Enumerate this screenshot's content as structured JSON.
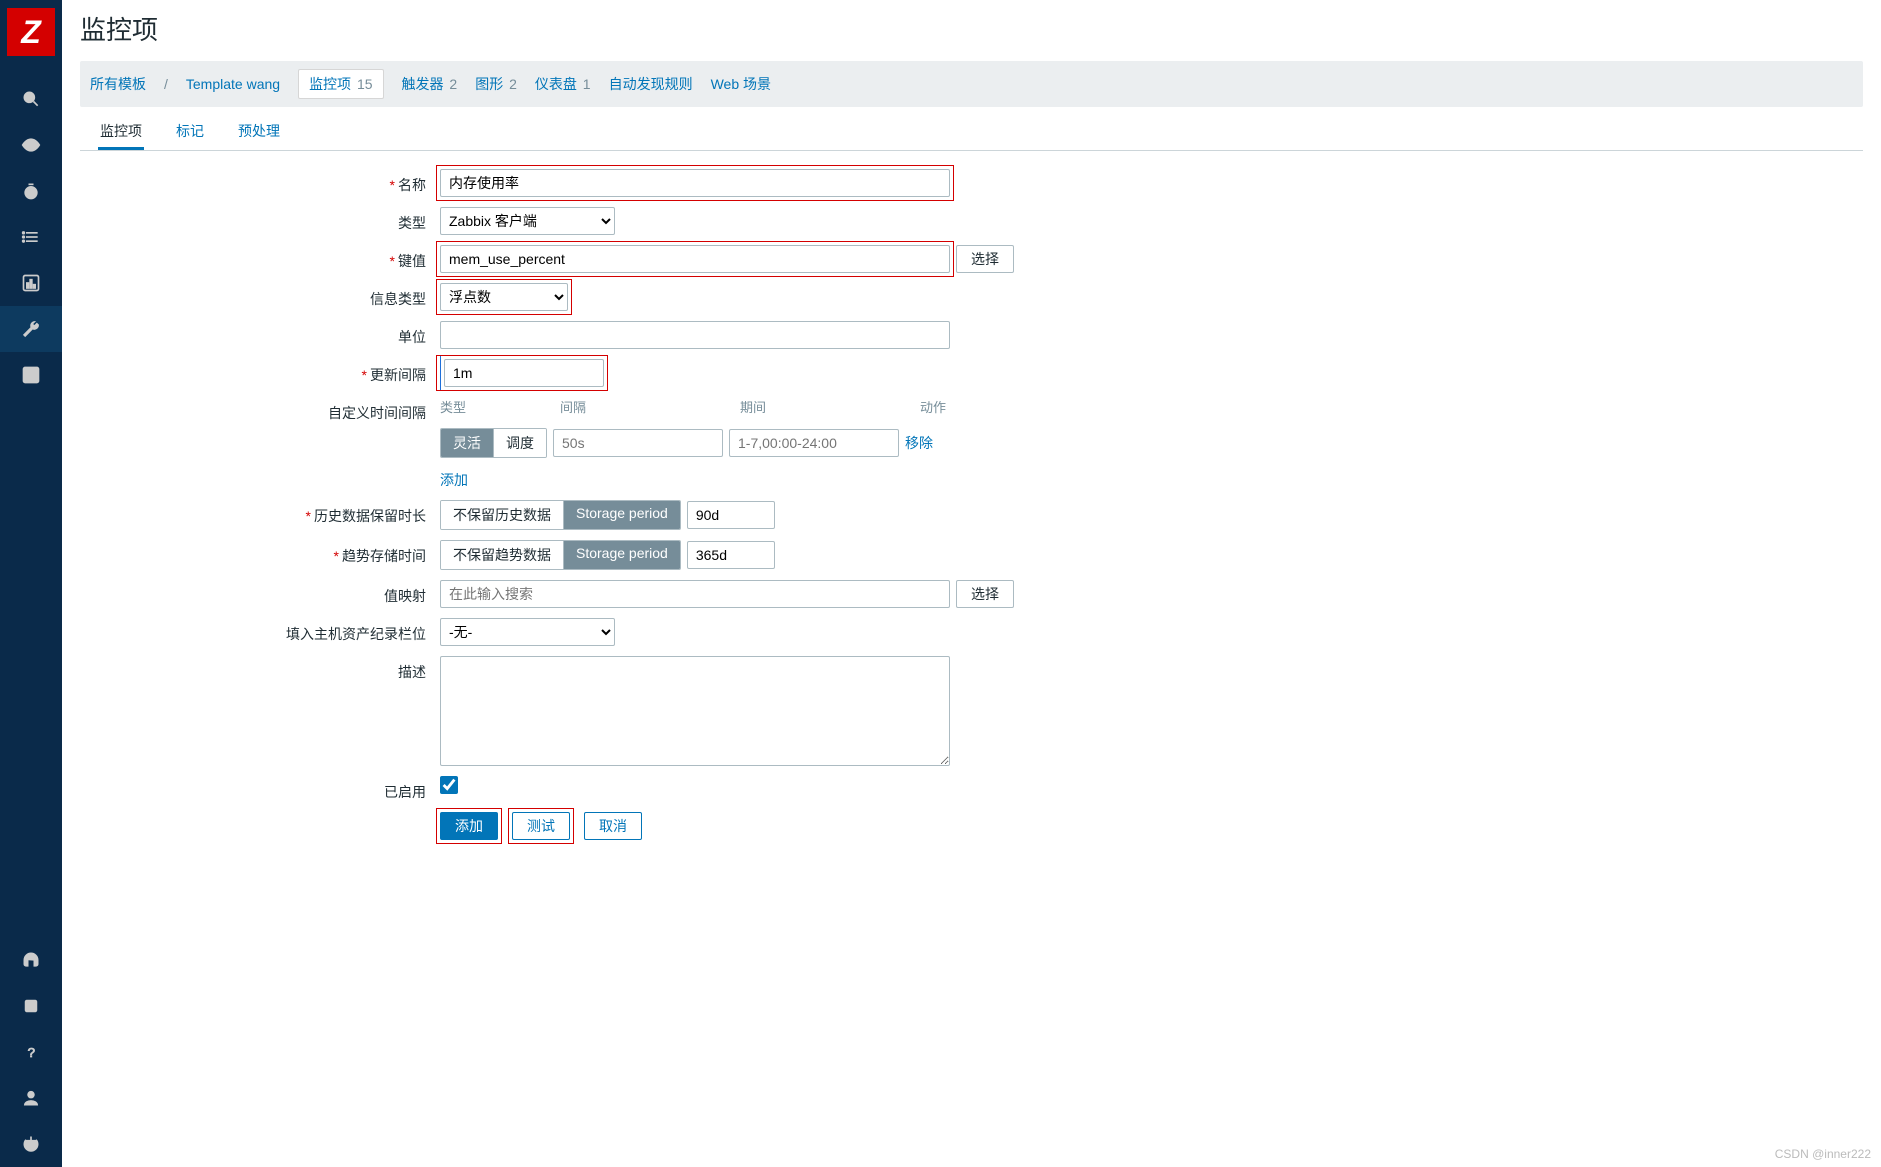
{
  "sidebar": {
    "logo": "Z"
  },
  "page": {
    "title": "监控项"
  },
  "breadcrumb": {
    "all_templates": "所有模板",
    "template_name": "Template wang",
    "tabs": {
      "items": {
        "label": "监控项",
        "count": "15"
      },
      "triggers": {
        "label": "触发器",
        "count": "2"
      },
      "graphs": {
        "label": "图形",
        "count": "2"
      },
      "dashboards": {
        "label": "仪表盘",
        "count": "1"
      },
      "discovery": {
        "label": "自动发现规则"
      },
      "web": {
        "label": "Web 场景"
      }
    }
  },
  "subtabs": {
    "item": "监控项",
    "tags": "标记",
    "preprocessing": "预处理"
  },
  "form": {
    "labels": {
      "name": "名称",
      "type": "类型",
      "key": "键值",
      "info_type": "信息类型",
      "units": "单位",
      "update_interval": "更新间隔",
      "custom_intervals": "自定义时间间隔",
      "history": "历史数据保留时长",
      "trends": "趋势存储时间",
      "value_map": "值映射",
      "inventory": "填入主机资产纪录栏位",
      "description": "描述",
      "enabled": "已启用"
    },
    "values": {
      "name": "内存使用率",
      "type": "Zabbix 客户端",
      "key": "mem_use_percent",
      "info_type": "浮点数",
      "units": "",
      "update_interval": "1m",
      "history_value": "90d",
      "trends_value": "365d",
      "value_map_placeholder": "在此输入搜索",
      "inventory": "-无-",
      "description": "",
      "enabled": true
    },
    "intervals": {
      "header": {
        "type": "类型",
        "interval": "间隔",
        "period": "期间",
        "action": "动作"
      },
      "seg": {
        "flexible": "灵活",
        "scheduling": "调度"
      },
      "row": {
        "interval_placeholder": "50s",
        "period_placeholder": "1-7,00:00-24:00"
      },
      "remove": "移除",
      "add": "添加"
    },
    "history_seg": {
      "do_not_keep": "不保留历史数据",
      "storage_period": "Storage period"
    },
    "trends_seg": {
      "do_not_keep": "不保留趋势数据",
      "storage_period": "Storage period"
    },
    "buttons": {
      "select": "选择",
      "add": "添加",
      "test": "测试",
      "cancel": "取消"
    }
  },
  "watermark": "CSDN @inner222"
}
